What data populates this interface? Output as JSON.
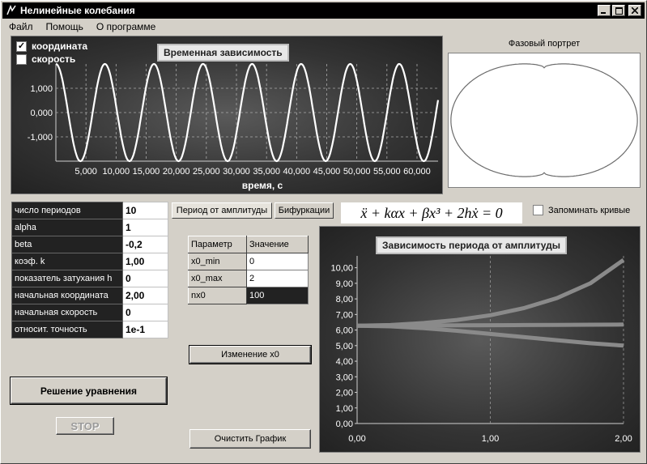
{
  "window": {
    "title": "Нелинейные колебания",
    "controls": [
      "minimize",
      "maximize",
      "close"
    ]
  },
  "menu": {
    "items": [
      "Файл",
      "Помощь",
      "О программе"
    ]
  },
  "time_panel": {
    "title": "Временная зависимость",
    "checkboxes": [
      {
        "label": "координата",
        "checked": true
      },
      {
        "label": "скорость",
        "checked": false
      }
    ],
    "xlabel": "время, с"
  },
  "phase_panel": {
    "title": "Фазовый портрет"
  },
  "params": [
    {
      "label": "число периодов",
      "value": "10"
    },
    {
      "label": "alpha",
      "value": "1"
    },
    {
      "label": "beta",
      "value": "-0,2"
    },
    {
      "label": "коэф. k",
      "value": "1,00"
    },
    {
      "label": "показатель затухания h",
      "value": "0"
    },
    {
      "label": "начальная координата",
      "value": "2,00"
    },
    {
      "label": "начальная скорость",
      "value": "0"
    },
    {
      "label": "относит. точность",
      "value": "1e-1"
    }
  ],
  "tabs": {
    "period": "Период от амплитуды",
    "bifurcation": "Бифуркации"
  },
  "equation": {
    "text": "ẍ + kαx + βx³ + 2hẋ = 0"
  },
  "remember_curves": {
    "label": "Запоминать кривые",
    "checked": false
  },
  "settings_table": {
    "headers": [
      "Параметр",
      "Значение"
    ],
    "rows": [
      {
        "param": "x0_min",
        "value": "0"
      },
      {
        "param": "x0_max",
        "value": "2"
      },
      {
        "param": "nx0",
        "value": "100"
      }
    ]
  },
  "buttons": {
    "change_x0": "Изменение x0",
    "clear_chart": "Очистить График",
    "solve": "Решение уравнения",
    "stop": "STOP"
  },
  "colors": {
    "line_white": "#ffffff",
    "period_curve": "#8a8a8a",
    "phase_curve": "#6b6b6b"
  },
  "chart_data": [
    {
      "type": "line",
      "title": "Временная зависимость",
      "xlabel": "время, с",
      "ylabel": "",
      "x_tick_labels": [
        "5,000",
        "10,000",
        "15,000",
        "20,000",
        "25,000",
        "30,000",
        "35,000",
        "40,000",
        "45,000",
        "50,000",
        "55,000",
        "60,000"
      ],
      "y_tick_labels": [
        "1,000",
        "0,000",
        "-1,000"
      ],
      "xlim": [
        0,
        63.5
      ],
      "ylim": [
        -2,
        2
      ],
      "grid": true,
      "series": [
        {
          "name": "координата",
          "amplitude": 2.0,
          "period": 8.15,
          "phase": 0
        }
      ]
    },
    {
      "type": "line",
      "title": "Фазовый портрет",
      "xlim": [
        -2.05,
        2.05
      ],
      "ylim": [
        -2.3,
        2.3
      ],
      "grid": false,
      "series": [
        {
          "shape": "closed orbit",
          "x_max": 2.0,
          "v_max": 2.2
        }
      ]
    },
    {
      "type": "line",
      "title": "Зависимость периода от амплитуды",
      "x_tick_labels": [
        "0,00",
        "1,00",
        "2,00"
      ],
      "y_tick_labels": [
        "0,00",
        "1,00",
        "2,00",
        "3,00",
        "4,00",
        "5,00",
        "6,00",
        "7,00",
        "8,00",
        "9,00",
        "10,00"
      ],
      "xlim": [
        0,
        2
      ],
      "ylim": [
        0,
        10.5
      ],
      "grid": true,
      "series": [
        {
          "x": [
            0,
            0.25,
            0.5,
            0.75,
            1.0,
            1.25,
            1.5,
            1.75,
            2.0
          ],
          "values": [
            6.28,
            6.32,
            6.45,
            6.65,
            6.95,
            7.4,
            8.05,
            9.0,
            10.5
          ]
        },
        {
          "x": [
            0,
            0.25,
            0.5,
            0.75,
            1.0,
            1.25,
            1.5,
            1.75,
            2.0
          ],
          "values": [
            6.28,
            6.28,
            6.29,
            6.3,
            6.31,
            6.32,
            6.33,
            6.34,
            6.35
          ]
        },
        {
          "x": [
            0,
            0.25,
            0.5,
            0.75,
            1.0,
            1.25,
            1.5,
            1.75,
            2.0
          ],
          "values": [
            6.28,
            6.24,
            6.12,
            5.95,
            5.75,
            5.55,
            5.35,
            5.15,
            5.0
          ]
        }
      ]
    }
  ]
}
